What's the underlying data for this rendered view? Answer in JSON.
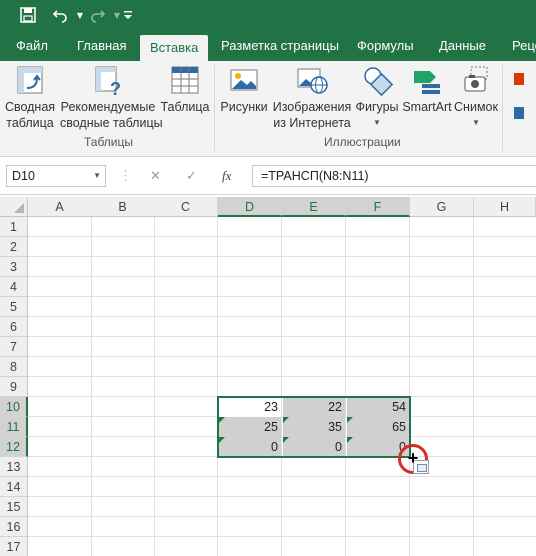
{
  "quick_access": {
    "save_icon": "save-icon",
    "undo_icon": "undo-icon",
    "redo_icon": "redo-icon",
    "customize_icon": "customize-icon"
  },
  "tabs": [
    {
      "label": "Файл"
    },
    {
      "label": "Главная"
    },
    {
      "label": "Вставка",
      "active": true
    },
    {
      "label": "Разметка страницы"
    },
    {
      "label": "Формулы"
    },
    {
      "label": "Данные"
    },
    {
      "label": "Реце"
    }
  ],
  "ribbon": {
    "tables": {
      "group_label": "Таблицы",
      "pivot": {
        "line1": "Сводная",
        "line2": "таблица"
      },
      "recommended_pivot": {
        "line1": "Рекомендуемые",
        "line2": "сводные таблицы"
      },
      "table": {
        "line1": "Таблица"
      }
    },
    "illustrations": {
      "group_label": "Иллюстрации",
      "pictures": {
        "line1": "Рисунки"
      },
      "online_pictures": {
        "line1": "Изображения",
        "line2": "из Интернета"
      },
      "shapes": {
        "line1": "Фигуры"
      },
      "smartart": {
        "line1": "SmartArt"
      },
      "screenshot": {
        "line1": "Снимок"
      }
    }
  },
  "formula_bar": {
    "name_box": "D10",
    "cancel_icon": "✕",
    "enter_icon": "✓",
    "fx_label": "fx",
    "formula": "=ТРАНСП(N8:N11)"
  },
  "sheet": {
    "columns": [
      "A",
      "B",
      "C",
      "D",
      "E",
      "F",
      "G",
      "H"
    ],
    "rows": [
      "1",
      "2",
      "3",
      "4",
      "5",
      "6",
      "7",
      "8",
      "9",
      "10",
      "11",
      "12",
      "13",
      "14",
      "15",
      "16",
      "17"
    ],
    "cells": {
      "D10": "23",
      "E10": "22",
      "F10": "54",
      "D11": "25",
      "E11": "35",
      "F11": "65",
      "D12": "0",
      "E12": "0",
      "F12": "0"
    }
  },
  "colors": {
    "accent": "#217346",
    "selection_fill": "#d0d0d0",
    "highlight_circle": "#d92b2b"
  }
}
